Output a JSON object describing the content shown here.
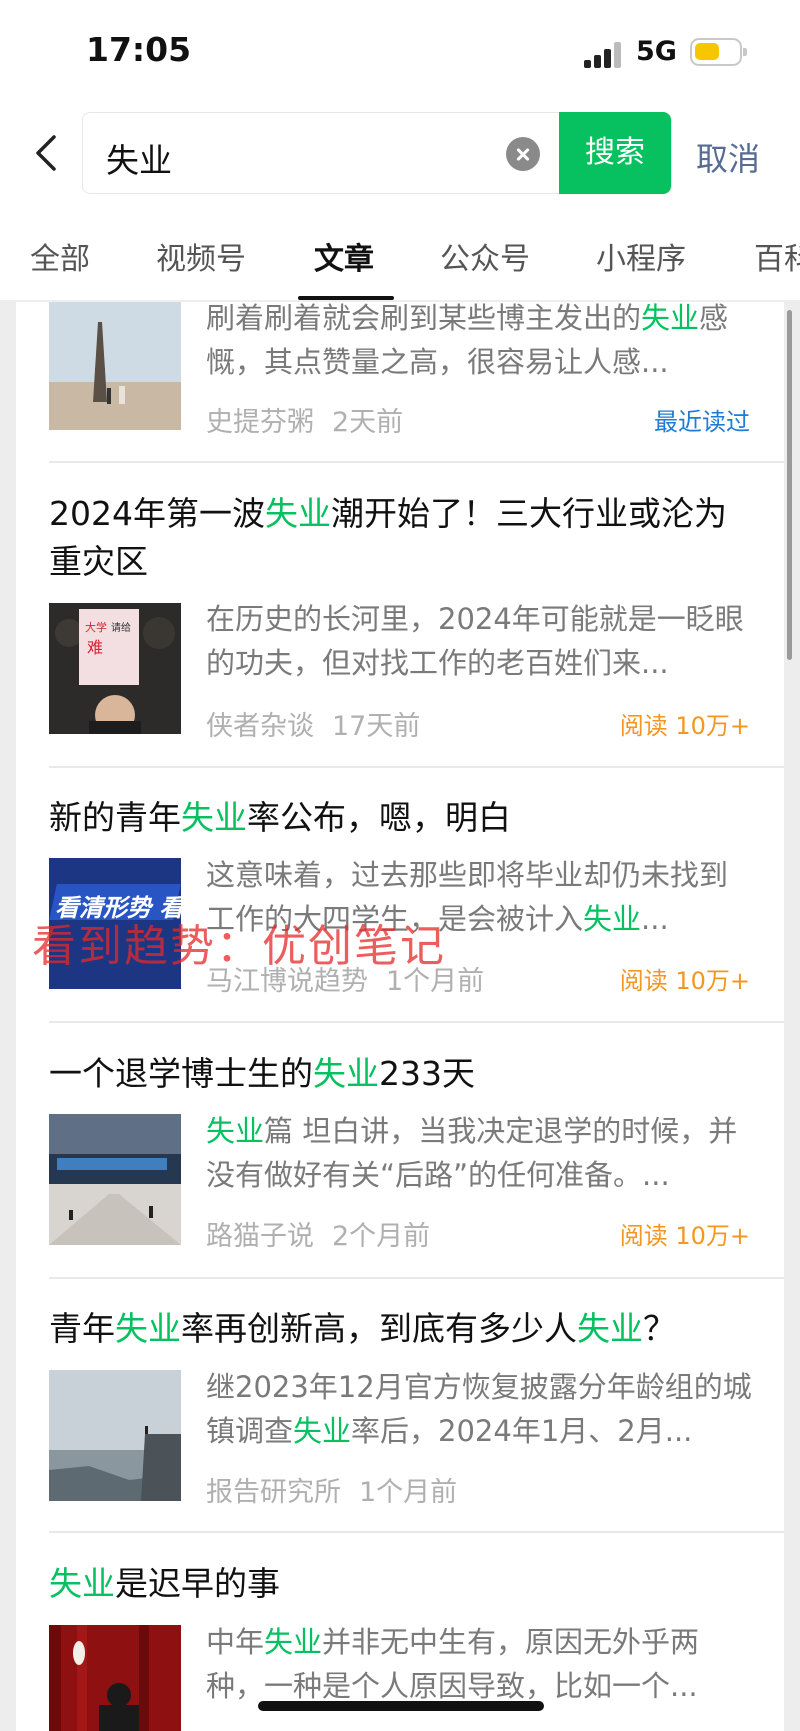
{
  "status_bar": {
    "time": "17:05",
    "network": "5G"
  },
  "search": {
    "query": "失业",
    "search_label": "搜索",
    "cancel_label": "取消"
  },
  "tabs": [
    "全部",
    "视频号",
    "文章",
    "公众号",
    "小程序",
    "百科"
  ],
  "active_tab": "文章",
  "articles": [
    {
      "title": "",
      "desc_prefix": "刷着刷着就会刷到某些博主发出的",
      "desc_hl": "失业",
      "desc_rest": "感慨，其点赞量之高，很容易让人感...",
      "author": "史提芬粥",
      "time": "2天前",
      "tag": "最近读过"
    },
    {
      "title_pre": "2024年第一波",
      "title_hl": "失业",
      "title_post": "潮开始了！三大行业或沦为重灾区",
      "desc": "在历史的长河里，2024年可能就是一眨眼的功夫，但对找工作的老百姓们来...",
      "author": "侠者杂谈",
      "time": "17天前",
      "tag": "阅读 10万+"
    },
    {
      "title_pre": "新的青年",
      "title_hl": "失业",
      "title_post": "率公布，嗯，明白",
      "desc_prefix": "这意味着，过去那些即将毕业却仍未找到工作的大四学生，是会被计入",
      "desc_hl": "失业",
      "desc_rest": "...",
      "author": "马江博说趋势",
      "time": "1个月前",
      "tag": "阅读 10万+",
      "thumb_text": "看清形势 看到趋势"
    },
    {
      "title_pre": "一个退学博士生的",
      "title_hl": "失业",
      "title_post": "233天",
      "desc_hl": "失业",
      "desc_rest": "篇 坦白讲，当我决定退学的时候，并没有做好有关“后路”的任何准备。...",
      "author": "路猫子说",
      "time": "2个月前",
      "tag": "阅读 10万+"
    },
    {
      "title_pre": "青年",
      "title_hl": "失业",
      "title_mid": "率再创新高，到底有多少人",
      "title_hl2": "失业",
      "title_post": "？",
      "desc_prefix": "继2023年12月官方恢复披露分年龄组的城镇调查",
      "desc_hl": "失业",
      "desc_rest": "率后，2024年1月、2月...",
      "author": "报告研究所",
      "time": "1个月前"
    },
    {
      "title_hl": "失业",
      "title_post": "是迟早的事",
      "desc_prefix": "中年",
      "desc_hl": "失业",
      "desc_rest": "并非无中生有，原因无外乎两种，一种是个人原因导致，比如一个..."
    }
  ],
  "watermark": "看到趋势：优创笔记",
  "thumb1_sign": "大学生就业难吗？请给个工作"
}
